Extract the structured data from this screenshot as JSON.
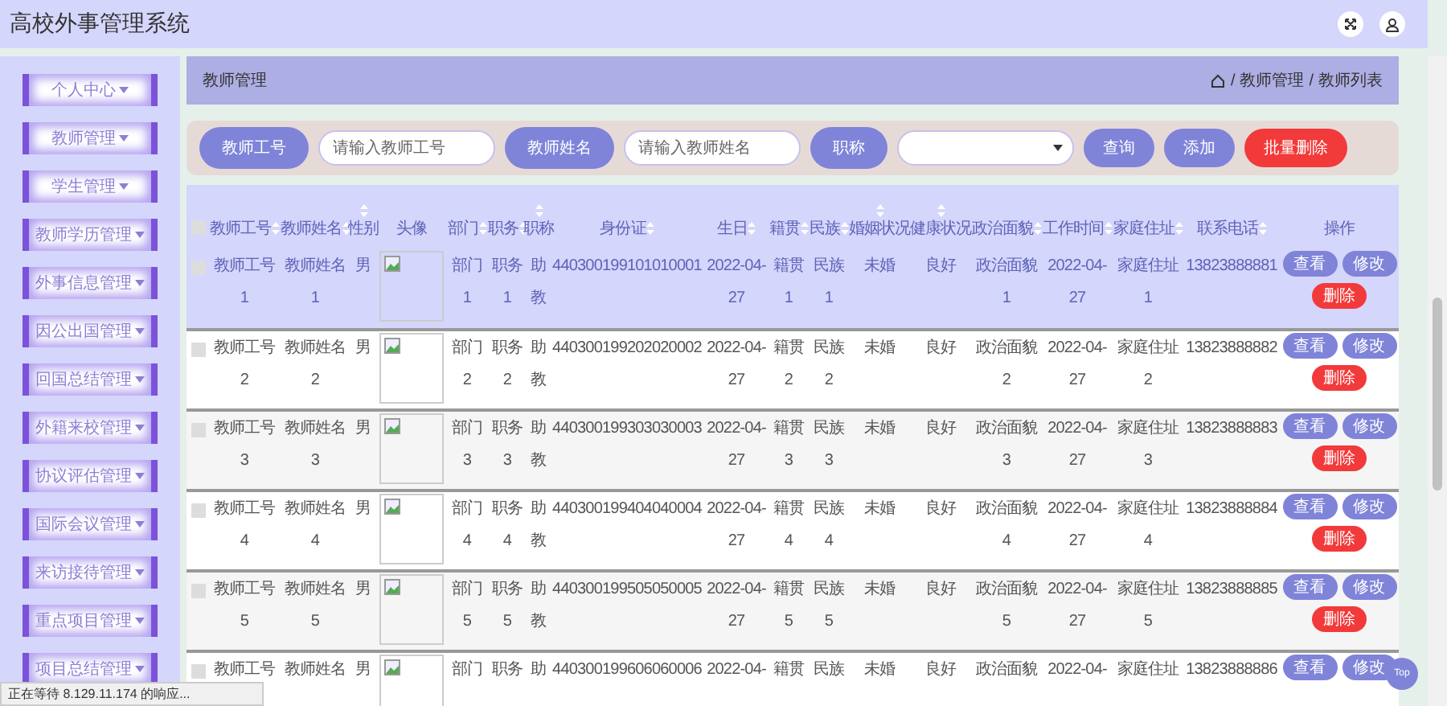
{
  "header": {
    "title": "高校外事管理系统"
  },
  "sidebar": {
    "items": [
      {
        "label": "个人中心"
      },
      {
        "label": "教师管理"
      },
      {
        "label": "学生管理"
      },
      {
        "label": "教师学历管理"
      },
      {
        "label": "外事信息管理"
      },
      {
        "label": "因公出国管理"
      },
      {
        "label": "回国总结管理"
      },
      {
        "label": "外籍来校管理"
      },
      {
        "label": "协议评估管理"
      },
      {
        "label": "国际会议管理"
      },
      {
        "label": "来访接待管理"
      },
      {
        "label": "重点项目管理"
      },
      {
        "label": "项目总结管理"
      }
    ]
  },
  "page_bar": {
    "title": "教师管理",
    "breadcrumb": [
      {
        "separator": "/",
        "label": "教师管理"
      },
      {
        "separator": "/",
        "label": "教师列表"
      }
    ]
  },
  "search": {
    "fields": [
      {
        "label": "教师工号",
        "placeholder": "请输入教师工号"
      },
      {
        "label": "教师姓名",
        "placeholder": "请输入教师姓名"
      }
    ],
    "select_label": "职称",
    "buttons": [
      {
        "label": "查询",
        "kind": "primary"
      },
      {
        "label": "添加",
        "kind": "primary"
      },
      {
        "label": "批量删除",
        "kind": "danger"
      }
    ]
  },
  "table": {
    "select_all": {
      "checked": false
    },
    "columns": [
      {
        "kind": "text",
        "label": "教师工号",
        "sortable": true
      },
      {
        "kind": "text",
        "label": "教师姓名",
        "sortable": true
      },
      {
        "kind": "text",
        "label": "性别",
        "sortable": true
      },
      {
        "kind": "image",
        "label": "头像",
        "sortable": false
      },
      {
        "kind": "text",
        "label": "部门",
        "sortable": true
      },
      {
        "kind": "text",
        "label": "职务",
        "sortable": true
      },
      {
        "kind": "text",
        "label": "职称",
        "sortable": true
      },
      {
        "kind": "text",
        "label": "身份证",
        "sortable": true
      },
      {
        "kind": "text",
        "label": "生日",
        "sortable": true
      },
      {
        "kind": "text",
        "label": "籍贯",
        "sortable": true
      },
      {
        "kind": "text",
        "label": "民族",
        "sortable": true
      },
      {
        "kind": "text",
        "label": "婚姻状况",
        "sortable": true
      },
      {
        "kind": "text",
        "label": "健康状况",
        "sortable": true
      },
      {
        "kind": "text",
        "label": "政治面貌",
        "sortable": true
      },
      {
        "kind": "text",
        "label": "工作时间",
        "sortable": true
      },
      {
        "kind": "text",
        "label": "家庭住址",
        "sortable": true
      },
      {
        "kind": "text",
        "label": "联系电话",
        "sortable": true
      },
      {
        "kind": "actions",
        "label": "操作",
        "sortable": false
      }
    ],
    "rows": [
      {
        "highlighted": true,
        "checked": false,
        "cells": [
          "教师工号1",
          "教师姓名1",
          "男",
          {
            "kind": "image"
          },
          "部门1",
          "职务1",
          "助教",
          "440300199101010001",
          "2022-04-27",
          "籍贯1",
          "民族1",
          "未婚",
          "良好",
          "政治面貌1",
          "2022-04-27",
          "家庭住址1",
          "13823888881"
        ],
        "actions": [
          {
            "label": "查看",
            "kind": "primary"
          },
          {
            "label": "修改",
            "kind": "primary"
          },
          {
            "label": "删除",
            "kind": "danger"
          }
        ]
      },
      {
        "highlighted": false,
        "checked": false,
        "cells": [
          "教师工号2",
          "教师姓名2",
          "男",
          {
            "kind": "image"
          },
          "部门2",
          "职务2",
          "助教",
          "440300199202020002",
          "2022-04-27",
          "籍贯2",
          "民族2",
          "未婚",
          "良好",
          "政治面貌2",
          "2022-04-27",
          "家庭住址2",
          "13823888882"
        ],
        "actions": [
          {
            "label": "查看",
            "kind": "primary"
          },
          {
            "label": "修改",
            "kind": "primary"
          },
          {
            "label": "删除",
            "kind": "danger"
          }
        ]
      },
      {
        "highlighted": false,
        "checked": false,
        "cells": [
          "教师工号3",
          "教师姓名3",
          "男",
          {
            "kind": "image"
          },
          "部门3",
          "职务3",
          "助教",
          "440300199303030003",
          "2022-04-27",
          "籍贯3",
          "民族3",
          "未婚",
          "良好",
          "政治面貌3",
          "2022-04-27",
          "家庭住址3",
          "13823888883"
        ],
        "actions": [
          {
            "label": "查看",
            "kind": "primary"
          },
          {
            "label": "修改",
            "kind": "primary"
          },
          {
            "label": "删除",
            "kind": "danger"
          }
        ]
      },
      {
        "highlighted": false,
        "checked": false,
        "cells": [
          "教师工号4",
          "教师姓名4",
          "男",
          {
            "kind": "image"
          },
          "部门4",
          "职务4",
          "助教",
          "440300199404040004",
          "2022-04-27",
          "籍贯4",
          "民族4",
          "未婚",
          "良好",
          "政治面貌4",
          "2022-04-27",
          "家庭住址4",
          "13823888884"
        ],
        "actions": [
          {
            "label": "查看",
            "kind": "primary"
          },
          {
            "label": "修改",
            "kind": "primary"
          },
          {
            "label": "删除",
            "kind": "danger"
          }
        ]
      },
      {
        "highlighted": false,
        "checked": false,
        "cells": [
          "教师工号5",
          "教师姓名5",
          "男",
          {
            "kind": "image"
          },
          "部门5",
          "职务5",
          "助教",
          "440300199505050005",
          "2022-04-27",
          "籍贯5",
          "民族5",
          "未婚",
          "良好",
          "政治面貌5",
          "2022-04-27",
          "家庭住址5",
          "13823888885"
        ],
        "actions": [
          {
            "label": "查看",
            "kind": "primary"
          },
          {
            "label": "修改",
            "kind": "primary"
          },
          {
            "label": "删除",
            "kind": "danger"
          }
        ]
      },
      {
        "highlighted": false,
        "checked": false,
        "cells": [
          "教师工号",
          "教师姓名",
          "男",
          {
            "kind": "image"
          },
          "部门",
          "职务",
          "助",
          "440300199606060006",
          "2022-04-",
          "籍贯",
          "民族",
          "未婚",
          "良好",
          "政治面貌",
          "2022-04-",
          "家庭住址",
          "13823888886"
        ],
        "actions": [
          {
            "label": "查看",
            "kind": "primary"
          },
          {
            "label": "修改",
            "kind": "primary"
          }
        ]
      }
    ]
  },
  "status_bar": {
    "text": "正在等待 8.129.11.174 的响应..."
  },
  "top_button": {
    "label": "Top"
  }
}
